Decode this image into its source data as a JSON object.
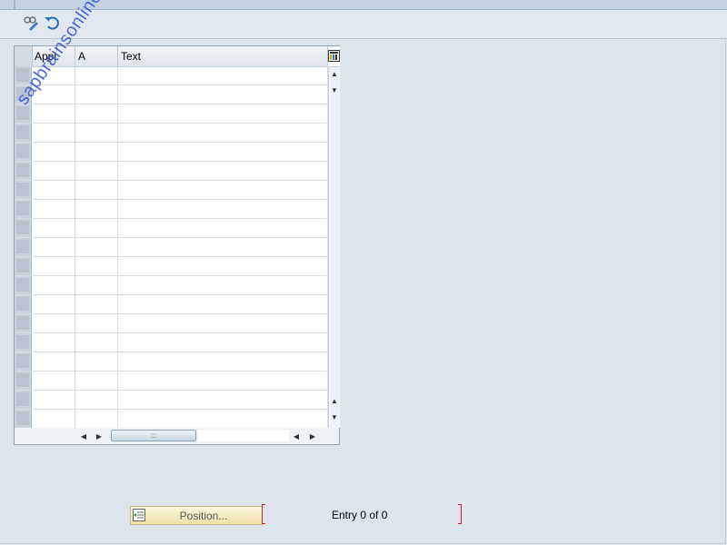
{
  "toolbar": {
    "buttons": [
      {
        "name": "display-change-icon"
      },
      {
        "name": "undo-icon"
      }
    ]
  },
  "table": {
    "columns": [
      "Appl.",
      "A",
      "Text"
    ],
    "row_count": 19,
    "settings_icon": "layout-settings-icon"
  },
  "watermark": {
    "text": "sapbrainsonline.com"
  },
  "footer": {
    "position_button": "Position...",
    "entry_text": "Entry 0 of 0"
  },
  "colors": {
    "watermark": "#3b5bd9",
    "position_button_bg": "#f0e1a8",
    "bracket": "#c4212a"
  }
}
